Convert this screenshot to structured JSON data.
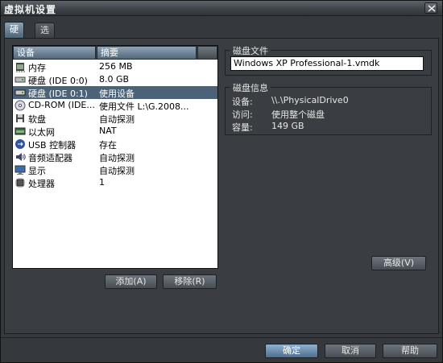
{
  "window": {
    "title": "虚拟机设置"
  },
  "tabs": [
    {
      "label": "硬件",
      "active": true
    },
    {
      "label": "选项",
      "active": false
    }
  ],
  "device_list": {
    "columns": [
      "设备",
      "摘要"
    ],
    "rows": [
      {
        "icon": "memory-icon",
        "name": "内存",
        "summary": "256 MB",
        "selected": false
      },
      {
        "icon": "hard-disk-icon",
        "name": "硬盘 (IDE 0:0)",
        "summary": "8.0 GB",
        "selected": false
      },
      {
        "icon": "hard-disk-icon",
        "name": "硬盘 (IDE 0:1)",
        "summary": "使用设备",
        "selected": true
      },
      {
        "icon": "cdrom-icon",
        "name": "CD-ROM (IDE...",
        "summary": "使用文件 L:\\G.2008...",
        "selected": false
      },
      {
        "icon": "floppy-icon",
        "name": "软盘",
        "summary": "自动探测",
        "selected": false
      },
      {
        "icon": "network-icon",
        "name": "以太网",
        "summary": "NAT",
        "selected": false
      },
      {
        "icon": "usb-icon",
        "name": "USB 控制器",
        "summary": "存在",
        "selected": false
      },
      {
        "icon": "sound-icon",
        "name": "音频适配器",
        "summary": "自动探测",
        "selected": false
      },
      {
        "icon": "display-icon",
        "name": "显示",
        "summary": "自动探测",
        "selected": false
      },
      {
        "icon": "processor-icon",
        "name": "处理器",
        "summary": "1",
        "selected": false
      }
    ]
  },
  "buttons": {
    "add": "添加(A)",
    "remove": "移除(R)",
    "advanced": "高级(V)",
    "ok": "确定",
    "cancel": "取消",
    "help": "帮助"
  },
  "disk_file": {
    "legend": "磁盘文件",
    "value": "Windows XP Professional-1.vmdk"
  },
  "disk_info": {
    "legend": "磁盘信息",
    "device_label": "设备:",
    "device_value": "\\\\.\\PhysicalDrive0",
    "access_label": "访问:",
    "access_value": "使用整个磁盘",
    "capacity_label": "容量:",
    "capacity_value": "149 GB"
  },
  "colors": {
    "selection": "#4b6278",
    "accent_tab": "#6e8498",
    "background": "#3a3e42"
  }
}
